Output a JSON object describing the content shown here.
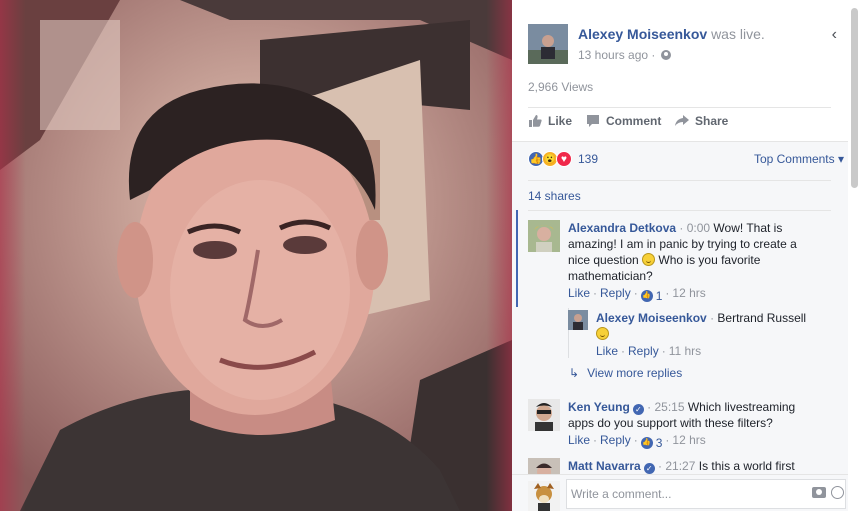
{
  "post": {
    "author": "Alexey Moiseenkov",
    "status": "was live.",
    "time": "13 hours ago",
    "dot": "·",
    "views": "2,966 Views",
    "back_icon": "‹"
  },
  "actions": {
    "like": "Like",
    "comment": "Comment",
    "share": "Share"
  },
  "reactions": {
    "count": "139",
    "top_comments": "Top Comments ▾",
    "shares": "14 shares",
    "colors": {
      "like": "#4267b2",
      "wow": "#f7b125",
      "love": "#f0284a"
    }
  },
  "comments": [
    {
      "name": "Alexandra Detkova",
      "meta": "· 0:00",
      "text_before": " Wow! That is amazing! I am in panic by trying to create a nice question ",
      "text_after": " Who is you favorite mathematician?",
      "like": "Like",
      "reply": "Reply",
      "likes": "1",
      "age": "12 hrs"
    },
    {
      "name": "Alexey Moiseenkov",
      "meta": "·",
      "text": " Bertrand Russell",
      "like": "Like",
      "reply": "Reply",
      "age": "11 hrs"
    },
    {
      "name": "Ken Yeung",
      "meta": "· 25:15",
      "text": " Which livestreaming apps do you support with these filters?",
      "like": "Like",
      "reply": "Reply",
      "likes": "3",
      "age": "12 hrs"
    },
    {
      "name": "Matt Navarra",
      "meta": "· 21:27",
      "text": " Is this a world first"
    }
  ],
  "more_replies": "View more replies",
  "composer": {
    "placeholder": "Write a comment..."
  }
}
